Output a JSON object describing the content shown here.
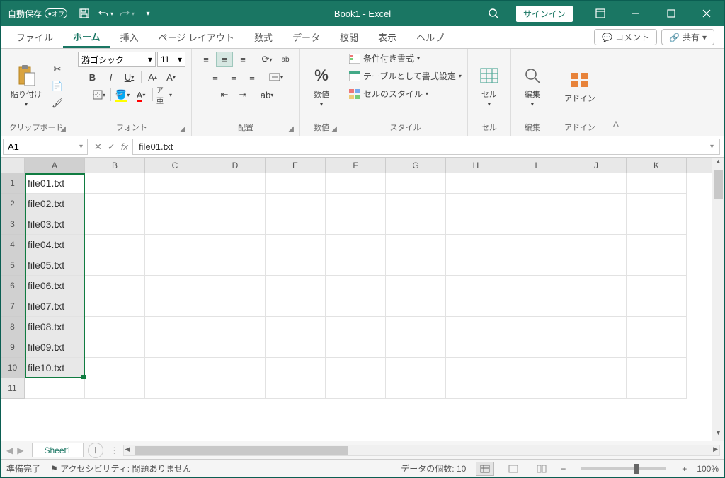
{
  "titlebar": {
    "autosave_label": "自動保存",
    "autosave_state": "オフ",
    "title": "Book1  -  Excel",
    "signin": "サインイン"
  },
  "tabs": {
    "items": [
      "ファイル",
      "ホーム",
      "挿入",
      "ページ レイアウト",
      "数式",
      "データ",
      "校閲",
      "表示",
      "ヘルプ"
    ],
    "active_index": 1,
    "comment": "コメント",
    "share": "共有"
  },
  "ribbon": {
    "clipboard": {
      "label": "クリップボード",
      "paste": "貼り付け"
    },
    "font": {
      "label": "フォント",
      "name": "游ゴシック",
      "size": "11",
      "bold": "B",
      "italic": "I",
      "underline": "U",
      "ruby": "ア亜"
    },
    "alignment": {
      "label": "配置",
      "wrap": "ab"
    },
    "number": {
      "label": "数値",
      "btn": "数値",
      "symbol": "%"
    },
    "styles": {
      "label": "スタイル",
      "conditional": "条件付き書式",
      "table": "テーブルとして書式設定",
      "cell": "セルのスタイル"
    },
    "cells": {
      "label": "セル",
      "btn": "セル"
    },
    "editing": {
      "label": "編集",
      "btn": "編集"
    },
    "addins": {
      "label": "アドイン",
      "btn": "アドイン"
    }
  },
  "formula_bar": {
    "name_box": "A1",
    "value": "file01.txt"
  },
  "grid": {
    "columns": [
      "A",
      "B",
      "C",
      "D",
      "E",
      "F",
      "G",
      "H",
      "I",
      "J",
      "K"
    ],
    "rows": [
      1,
      2,
      3,
      4,
      5,
      6,
      7,
      8,
      9,
      10,
      11
    ],
    "data_col_a": [
      "file01.txt",
      "file02.txt",
      "file03.txt",
      "file04.txt",
      "file05.txt",
      "file06.txt",
      "file07.txt",
      "file08.txt",
      "file09.txt",
      "file10.txt",
      ""
    ],
    "selected_rows": 10
  },
  "sheetbar": {
    "sheet": "Sheet1"
  },
  "statusbar": {
    "ready": "準備完了",
    "accessibility": "アクセシビリティ: 問題ありません",
    "count": "データの個数: 10",
    "zoom": "100%"
  }
}
